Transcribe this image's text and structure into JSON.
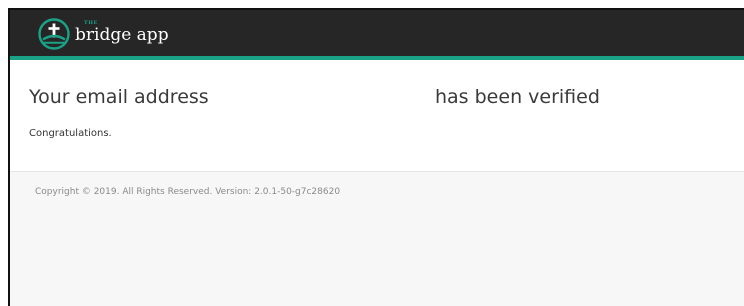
{
  "navbar": {
    "logo": {
      "the_label": "THE",
      "name": "bridge app",
      "icon": "bridge-cross-logo-icon"
    }
  },
  "main": {
    "heading_left": "Your email address",
    "heading_right": "has been verified",
    "message": "Congratulations."
  },
  "footer": {
    "copyright": "Copyright © 2019. All Rights Reserved. Version: 2.0.1-50-g7c28620"
  },
  "colors": {
    "navbar_bg": "#262626",
    "accent": "#1aa287",
    "page_bg": "#f7f7f7",
    "card_bg": "#ffffff",
    "heading_text": "#3a3a3a",
    "footer_text": "#8a8a8a"
  }
}
